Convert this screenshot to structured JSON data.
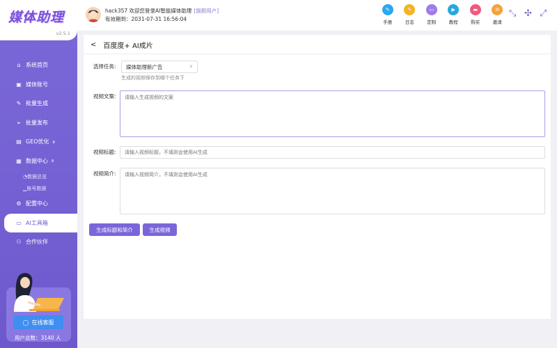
{
  "brand": {
    "logo_text": "媒体助理",
    "version": "v2.5.1"
  },
  "header": {
    "welcome": "hack357 欢迎您登录AI智能媒体助理",
    "user_tag": "[旗舰用户]",
    "expire": "有效期到：2031-07-31 16:56:04",
    "tools": [
      {
        "label": "手册",
        "icon": "manual-icon",
        "color": "#2aa8f0"
      },
      {
        "label": "日志",
        "icon": "log-icon",
        "color": "#f3b324"
      },
      {
        "label": "定制",
        "icon": "custom-icon",
        "color": "#9d7be8"
      },
      {
        "label": "教程",
        "icon": "tutorial-icon",
        "color": "#27a8e0"
      },
      {
        "label": "购买",
        "icon": "purchase-icon",
        "color": "#f05a7e"
      },
      {
        "label": "邀请",
        "icon": "invite-icon",
        "color": "#f4a23a"
      }
    ]
  },
  "sidebar": {
    "items": [
      {
        "label": "系统首页",
        "icon": "home-icon"
      },
      {
        "label": "媒体账号",
        "icon": "account-icon"
      },
      {
        "label": "批量生成",
        "icon": "edit-icon"
      },
      {
        "label": "批量发布",
        "icon": "send-icon"
      },
      {
        "label": "GEO优化",
        "icon": "doc-icon"
      },
      {
        "label": "数据中心",
        "icon": "data-icon"
      },
      {
        "label": "配置中心",
        "icon": "gear-icon"
      },
      {
        "label": "AI工具箱",
        "icon": "toolbox-icon"
      },
      {
        "label": "合作伙伴",
        "icon": "partner-icon"
      }
    ],
    "sub_items": [
      {
        "label": "数据总览"
      },
      {
        "label": "账号数据"
      }
    ],
    "service_button": "在线客服",
    "user_count": "用户总数：3140 人"
  },
  "main": {
    "title": "百度度+ AI成片",
    "task_label": "选择任务:",
    "task_value": "媒体助理新广告",
    "task_hint": "生成的视频保存到哪个任务下",
    "copy_label": "视频文案:",
    "copy_placeholder": "请输入生成视频的文案",
    "title_label": "视频标题:",
    "title_placeholder": "请输入视频标题，不填则会使用AI生成",
    "intro_label": "视频简介:",
    "intro_placeholder": "请输入视频简介，不填则会使用AI生成",
    "btn_generate_meta": "生成标题和简介",
    "btn_generate_video": "生成视频"
  }
}
